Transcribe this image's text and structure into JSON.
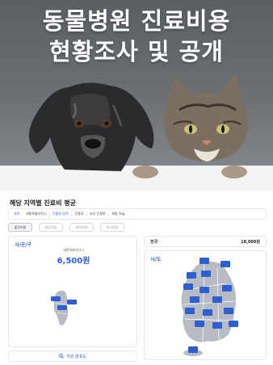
{
  "hero": {
    "title_line1": "동물병원 진료비용",
    "title_line2": "현황조사 및 공개"
  },
  "panel": {
    "title": "해당 지역별 진료비 평균",
    "breadcrumb": [
      {
        "label": "과목",
        "link": true
      },
      {
        "label": "세종특별자치시",
        "link": false
      },
      {
        "label": "진찰료 항목",
        "link": true
      },
      {
        "label": "진찰료",
        "link": false
      },
      {
        "label": "초진 진찰료",
        "link": false
      },
      {
        "label": "체중 5kg",
        "link": false
      }
    ],
    "tabs": [
      "중간비용",
      "평균비용",
      "최저비용",
      "최고비용"
    ],
    "active_tab": 0,
    "left_card": {
      "heading": "시/군/구",
      "region_name": "세종특별자치시",
      "region_price": "6,500원"
    },
    "national": {
      "label": "전국",
      "price": "18,000원"
    },
    "right_card": {
      "heading": "시/도"
    },
    "search_button": "지원 분포도"
  },
  "colors": {
    "accent": "#2a5fd8",
    "map_land": "#b7bcc4",
    "hero_bg": "#62666b"
  }
}
